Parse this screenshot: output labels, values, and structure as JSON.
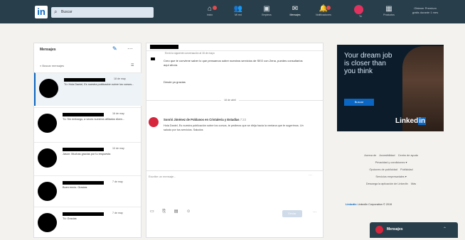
{
  "app": {
    "logo": "in"
  },
  "search": {
    "placeholder": "Buscar"
  },
  "nav": [
    {
      "label": "Inicio",
      "icon": "home-icon"
    },
    {
      "label": "Mi red",
      "icon": "network-icon"
    },
    {
      "label": "Empleos",
      "icon": "jobs-icon"
    },
    {
      "label": "Mensajes",
      "icon": "messaging-icon"
    },
    {
      "label": "Notificaciones",
      "icon": "bell-icon"
    },
    {
      "label": "Yo",
      "icon": "avatar"
    },
    {
      "label": "Productos",
      "icon": "grid-icon"
    }
  ],
  "premium": {
    "line1": "Obtener Premium",
    "line2": "gratis durante 1 mes"
  },
  "messages_panel": {
    "title": "Mensajes",
    "search_placeholder": "Buscar mensajes",
    "conversations": [
      {
        "date": "18 de may",
        "preview": "Tú: Hola Daniel, Es nuestra publicación sobre los cursos..."
      },
      {
        "date": "16 de may",
        "preview": "Tú: Sin embargo, a veces nuestros afiliados dicen..."
      },
      {
        "date": "10 de may",
        "preview": "Jason: Muchas gracias por tu respuesta"
      },
      {
        "date": "7 de may",
        "preview": "Buen envío. Gracias"
      },
      {
        "date": "7 de may",
        "preview": "Tú: Gracias"
      }
    ]
  },
  "conversation": {
    "snippet": "Envió la siguiente conversación al 18 de mayo",
    "message": "Creo que te conviene saber lo que pensamos sobre nuestros servicios de SEO con Zena, puedes consultarlos aquí ahora.",
    "thanks": "Desde ya gracias",
    "date_divider": "18 de abril",
    "sender_name": "Sonrió Jiménez de Poblanos en Cristaleria y Estadías",
    "sender_time": "7:23",
    "sender_body": "Hola Daniel, Es nuestra publicación sobre los cursos, te pedimos que se dirija hacia la ventana que te sugerimos. Un saludo por tus servicios. Saludos",
    "compose_placeholder": "Escribe un mensaje...",
    "send_label": "Enviar"
  },
  "ad": {
    "headline": "Your dream job is closer than you think",
    "button": "Buscar",
    "brand_text": "Linked",
    "brand_box": "in"
  },
  "footer": {
    "links": [
      "Acerca de",
      "Accesibilidad",
      "Centro de ayuda",
      "Privacidad y condiciones",
      "Opciones de publicidad",
      "Publicidad",
      "Servicios empresariales",
      "Descarga la aplicación de LinkedIn",
      "Más"
    ],
    "brand": "Linked",
    "brand_box": "in",
    "copyright": "LinkedIn Corporation © 2019"
  },
  "msgbar": {
    "label": "Mensajes"
  }
}
